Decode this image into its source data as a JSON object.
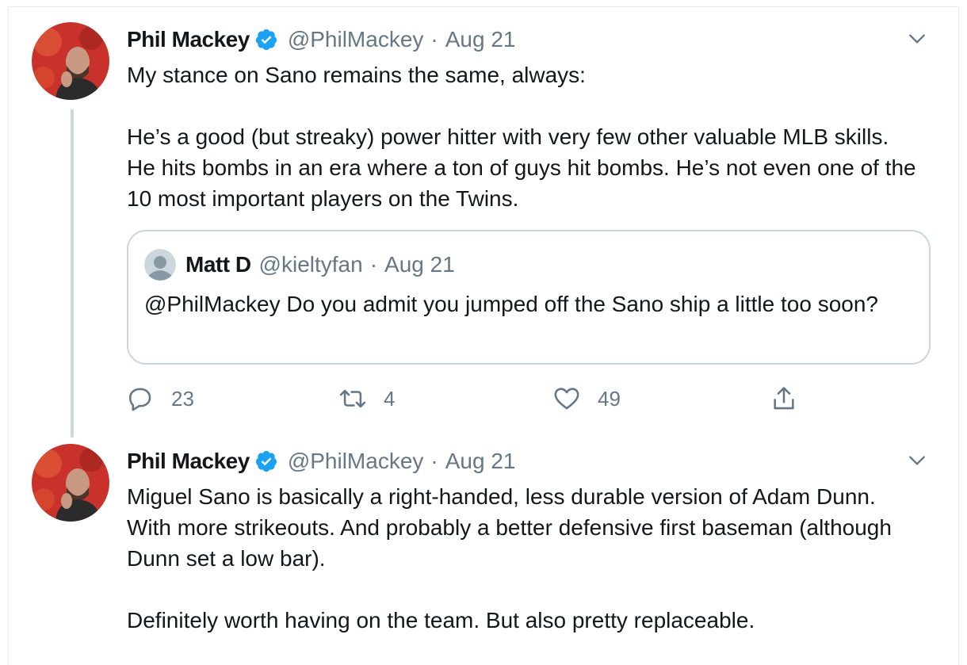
{
  "tweets": [
    {
      "author_name": "Phil Mackey",
      "handle": "@PhilMackey",
      "separator": "·",
      "date": "Aug 21",
      "text": "My stance on Sano remains the same, always:\n\nHe’s a good (but streaky) power hitter with very few other valuable MLB skills. He hits bombs in an era where a ton of guys hit bombs. He’s not even one of the 10 most important players on the Twins.",
      "quote": {
        "author_name": "Matt D",
        "handle": "@kieltyfan",
        "separator": "·",
        "date": "Aug 21",
        "text": "@PhilMackey Do you admit you jumped off the Sano ship a little too soon?"
      },
      "actions": {
        "reply_count": "23",
        "retweet_count": "4",
        "like_count": "49"
      }
    },
    {
      "author_name": "Phil Mackey",
      "handle": "@PhilMackey",
      "separator": "·",
      "date": "Aug 21",
      "text": "Miguel Sano is basically a right-handed, less durable version of Adam Dunn. With more strikeouts. And probably a better defensive first baseman (although Dunn set a low bar).\n\nDefinitely worth having on the team. But also pretty replaceable."
    }
  ],
  "colors": {
    "text": "#14171a",
    "muted": "#657786",
    "border": "#ccd6dd",
    "verified": "#1da1f2"
  },
  "icons": [
    "verified-badge-icon",
    "chevron-down-icon",
    "reply-icon",
    "retweet-icon",
    "like-icon",
    "share-icon",
    "default-avatar-icon"
  ]
}
